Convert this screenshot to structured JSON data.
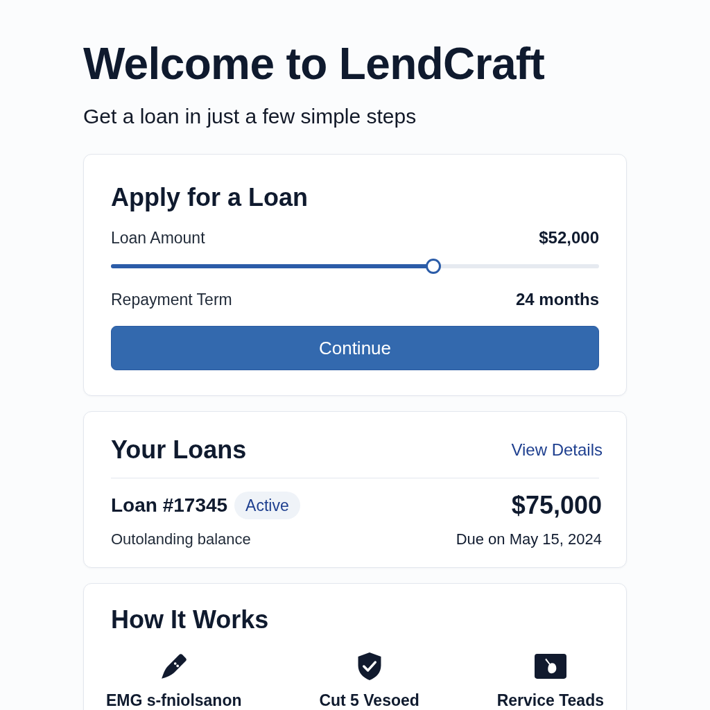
{
  "header": {
    "title": "Welcome to LendCraft",
    "subtitle": "Get a loan in just a few simple steps"
  },
  "apply_card": {
    "title": "Apply for a Loan",
    "fields": [
      {
        "kind": "slider",
        "label": "Loan Amount",
        "value": "$52,000",
        "level": 0.66
      },
      {
        "kind": "text",
        "label": "Repayment Term",
        "value": "24 months"
      }
    ],
    "button": "Continue"
  },
  "loans_card": {
    "title": "Your Loans",
    "link": "View Details",
    "loans": [
      {
        "name": "Loan #17345",
        "status": "Active",
        "amount": "$75,000",
        "balance_label": "Outolanding balance",
        "due": "Due on May 15, 2024"
      }
    ]
  },
  "how_it_works": {
    "title": "How It Works",
    "steps": [
      {
        "kind": "pen",
        "label": "EMG s-fniolsanon"
      },
      {
        "kind": "shield",
        "label": "Cut 5 Vesoed"
      },
      {
        "kind": "tile",
        "label": "Rervice Teads"
      }
    ]
  }
}
